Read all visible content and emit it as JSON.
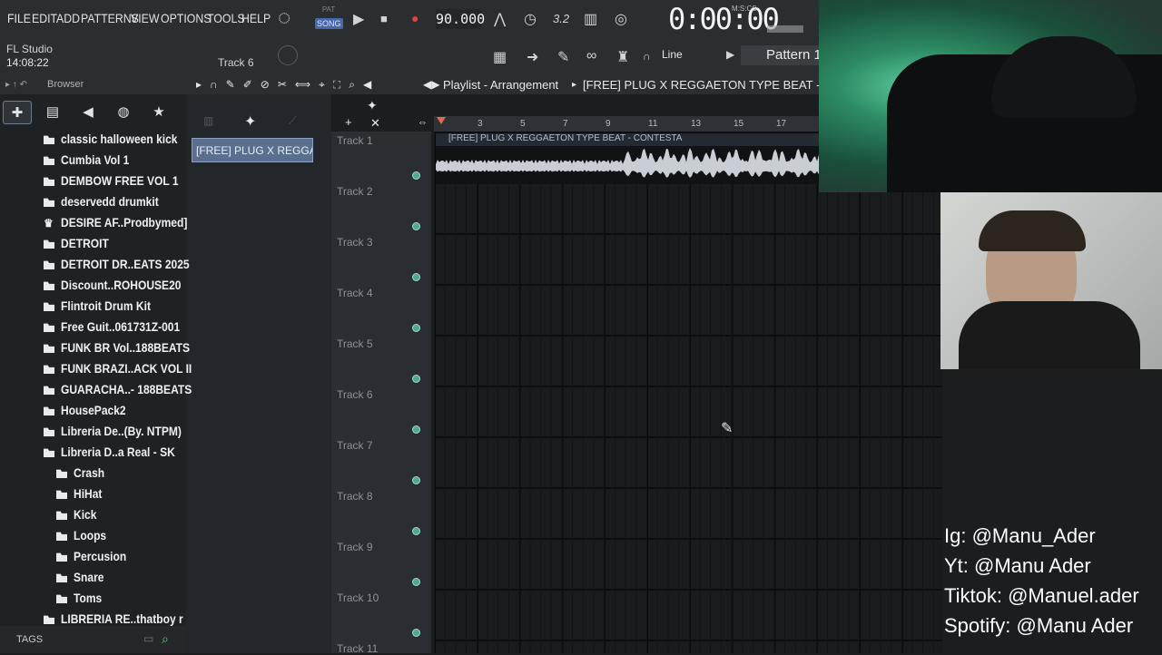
{
  "menu": [
    "FILE",
    "EDIT",
    "ADD",
    "PATTERNS",
    "VIEW",
    "OPTIONS",
    "TOOLS",
    "HELP"
  ],
  "transport": {
    "pat_label": "PAT",
    "song_label": "SONG",
    "tempo": "90.000",
    "time": "0:00:00",
    "time_format": "M:S:CS",
    "step_value": "3.2"
  },
  "info": {
    "app_name": "FL Studio",
    "clock": "14:08:22",
    "current_track": "Track 6",
    "snap": "Line",
    "pattern": "Pattern 1"
  },
  "browser": {
    "title": "Browser",
    "folders": [
      {
        "label": "classic halloween kick",
        "indent": 0
      },
      {
        "label": "Cumbia Vol 1",
        "indent": 0
      },
      {
        "label": "DEMBOW FREE VOL 1",
        "indent": 0
      },
      {
        "label": "deservedd drumkit",
        "indent": 0
      },
      {
        "label": "DESIRE AF..Prodbymed]",
        "indent": 0,
        "crown": true
      },
      {
        "label": "DETROIT",
        "indent": 0
      },
      {
        "label": "DETROIT DR..EATS 2025",
        "indent": 0
      },
      {
        "label": "Discount..ROHOUSE20",
        "indent": 0
      },
      {
        "label": "Flintroit Drum Kit",
        "indent": 0
      },
      {
        "label": "Free Guit..061731Z-001",
        "indent": 0
      },
      {
        "label": "FUNK BR Vol..188BEATS",
        "indent": 0
      },
      {
        "label": "FUNK BRAZI..ACK VOL II",
        "indent": 0
      },
      {
        "label": "GUARACHA..- 188BEATS",
        "indent": 0
      },
      {
        "label": "HousePack2",
        "indent": 0
      },
      {
        "label": "Libreria De..(By. NTPM)",
        "indent": 0
      },
      {
        "label": "Libreria D..a Real - SK",
        "indent": 0
      },
      {
        "label": "Crash",
        "indent": 1
      },
      {
        "label": "HiHat",
        "indent": 1
      },
      {
        "label": "Kick",
        "indent": 1
      },
      {
        "label": "Loops",
        "indent": 1
      },
      {
        "label": "Percusion",
        "indent": 1
      },
      {
        "label": "Snare",
        "indent": 1
      },
      {
        "label": "Toms",
        "indent": 1
      },
      {
        "label": "LIBRERIA RE..thatboy r",
        "indent": 0
      }
    ],
    "tags_label": "TAGS"
  },
  "channel_clip": "[FREE] PLUG X REGGA...",
  "playlist": {
    "title": "Playlist - Arrangement",
    "song_name": "[FREE] PLUG X REGGAETON TYPE BEAT - CO",
    "clip_title": "[FREE] PLUG X REGGAETON TYPE BEAT - CONTESTA",
    "ruler": [
      "3",
      "5",
      "7",
      "9",
      "11",
      "13",
      "15",
      "17"
    ],
    "tracks": [
      "Track 1",
      "Track 2",
      "Track 3",
      "Track 4",
      "Track 5",
      "Track 6",
      "Track 7",
      "Track 8",
      "Track 9",
      "Track 10",
      "Track 11"
    ]
  },
  "social": {
    "ig": "Ig: @Manu_Ader",
    "yt": "Yt: @Manu Ader",
    "tiktok": "Tiktok: @Manuel.ader",
    "spotify": "Spotify: @Manu Ader"
  }
}
